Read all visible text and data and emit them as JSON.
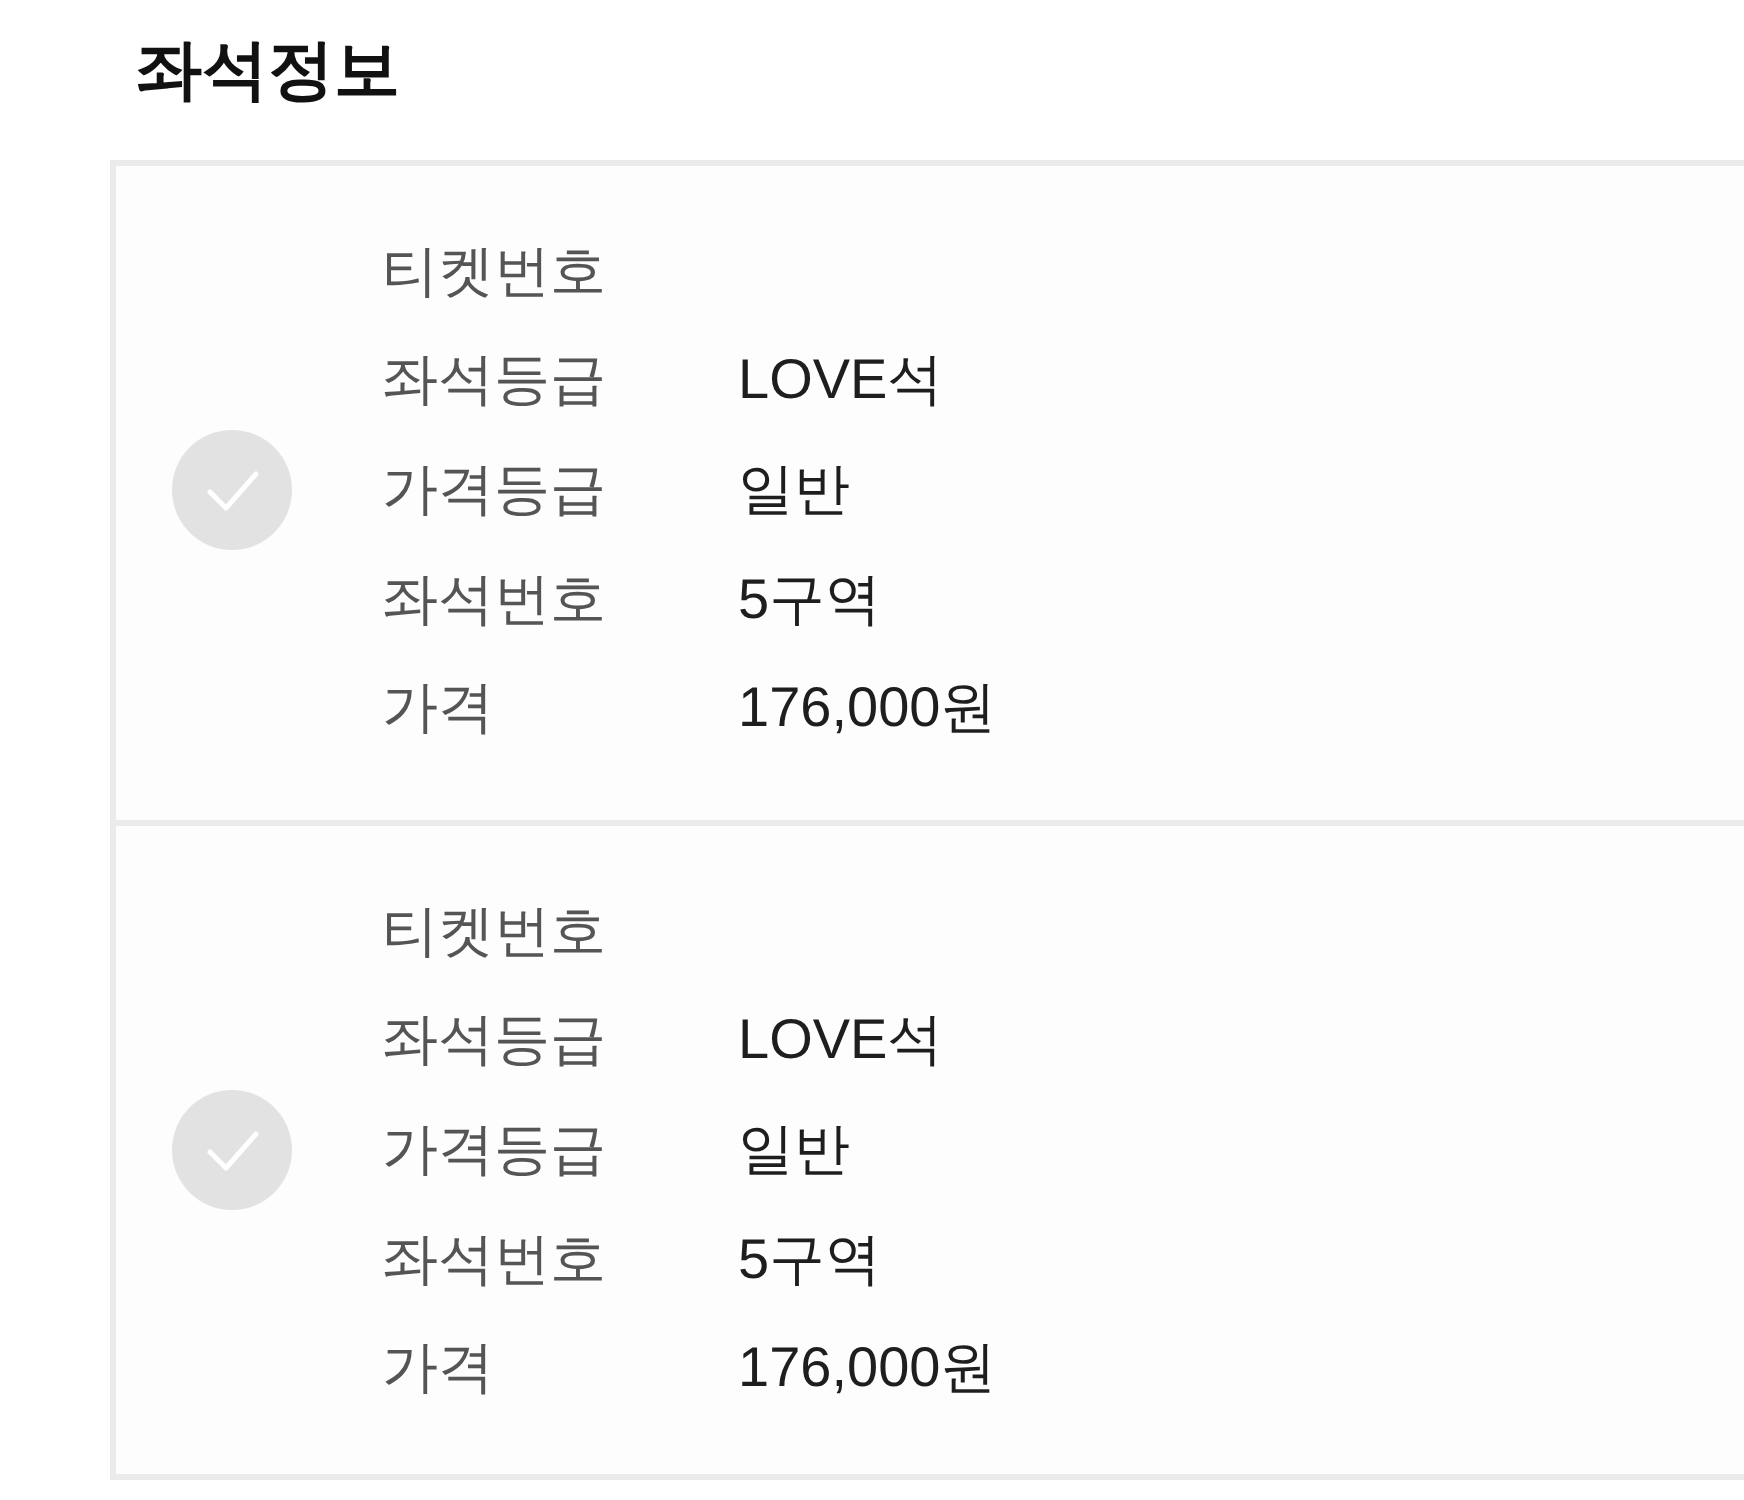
{
  "section_title": "좌석정보",
  "tickets": [
    {
      "selected": false,
      "fields": [
        {
          "label": "티켓번호"
        },
        {
          "label": "좌석등급",
          "value": "LOVE석"
        },
        {
          "label": "가격등급",
          "value": "일반"
        },
        {
          "label": "좌석번호",
          "value": "5구역"
        },
        {
          "label": "가격",
          "value": "176,000원"
        }
      ]
    },
    {
      "selected": false,
      "fields": [
        {
          "label": "티켓번호"
        },
        {
          "label": "좌석등급",
          "value": "LOVE석"
        },
        {
          "label": "가격등급",
          "value": "일반"
        },
        {
          "label": "좌석번호",
          "value": "5구역"
        },
        {
          "label": "가격",
          "value": "176,000원"
        }
      ]
    }
  ]
}
